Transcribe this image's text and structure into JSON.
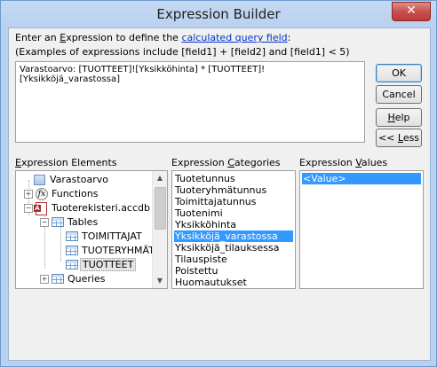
{
  "window": {
    "title": "Expression Builder",
    "close_glyph": "✕"
  },
  "instructions": {
    "line1_prefix": "Enter an ",
    "line1_e": "E",
    "line1_mid": "xpression to define the ",
    "line1_link": "calculated query field",
    "line1_suffix": ":",
    "line2": "(Examples of expressions include [field1] + [field2] and [field1] < 5)"
  },
  "expression": {
    "value": "Varastoarvo:  [TUOTTEET]![Yksikköhinta] * [TUOTTEET]![Yksikköjä_varastossa]"
  },
  "buttons": {
    "ok": "OK",
    "cancel": "Cancel",
    "help_h": "H",
    "help_rest": "elp",
    "less_prefix": "<< ",
    "less_l": "L",
    "less_rest": "ess"
  },
  "elements": {
    "label_prefix": "E",
    "label_x": "x",
    "label_rest": "pression Elements",
    "tree": [
      {
        "label": "Varastoarvo",
        "icon": "query-icon"
      },
      {
        "label": "Functions",
        "icon": "functions-icon"
      },
      {
        "label": "Tuoterekisteri.accdb",
        "icon": "access-db-icon"
      },
      {
        "label": "Tables",
        "icon": "tables-icon"
      },
      {
        "label": "TOIMITTAJAT",
        "icon": "table-icon"
      },
      {
        "label": "TUOTERYHMÄT",
        "icon": "table-icon"
      },
      {
        "label": "TUOTTEET",
        "icon": "table-icon"
      },
      {
        "label": "Queries",
        "icon": "queries-icon"
      }
    ]
  },
  "categories": {
    "label_prefix": "Expression ",
    "label_c": "C",
    "label_rest": "ategories",
    "items": [
      "Tuotetunnus",
      "Tuoteryhmätunnus",
      "Toimittajatunnus",
      "Tuotenimi",
      "Yksikköhinta",
      "Yksikköjä_varastossa",
      "Yksikköjä_tilauksessa",
      "Tilauspiste",
      "Poistettu",
      "Huomautukset"
    ],
    "selected_index": 5
  },
  "values": {
    "label_prefix": "Expression ",
    "label_v": "V",
    "label_rest": "alues",
    "items": [
      "<Value>"
    ],
    "selected_index": 0
  },
  "colors": {
    "selection": "#3399ff",
    "link": "#0033cc",
    "close": "#c75050"
  }
}
